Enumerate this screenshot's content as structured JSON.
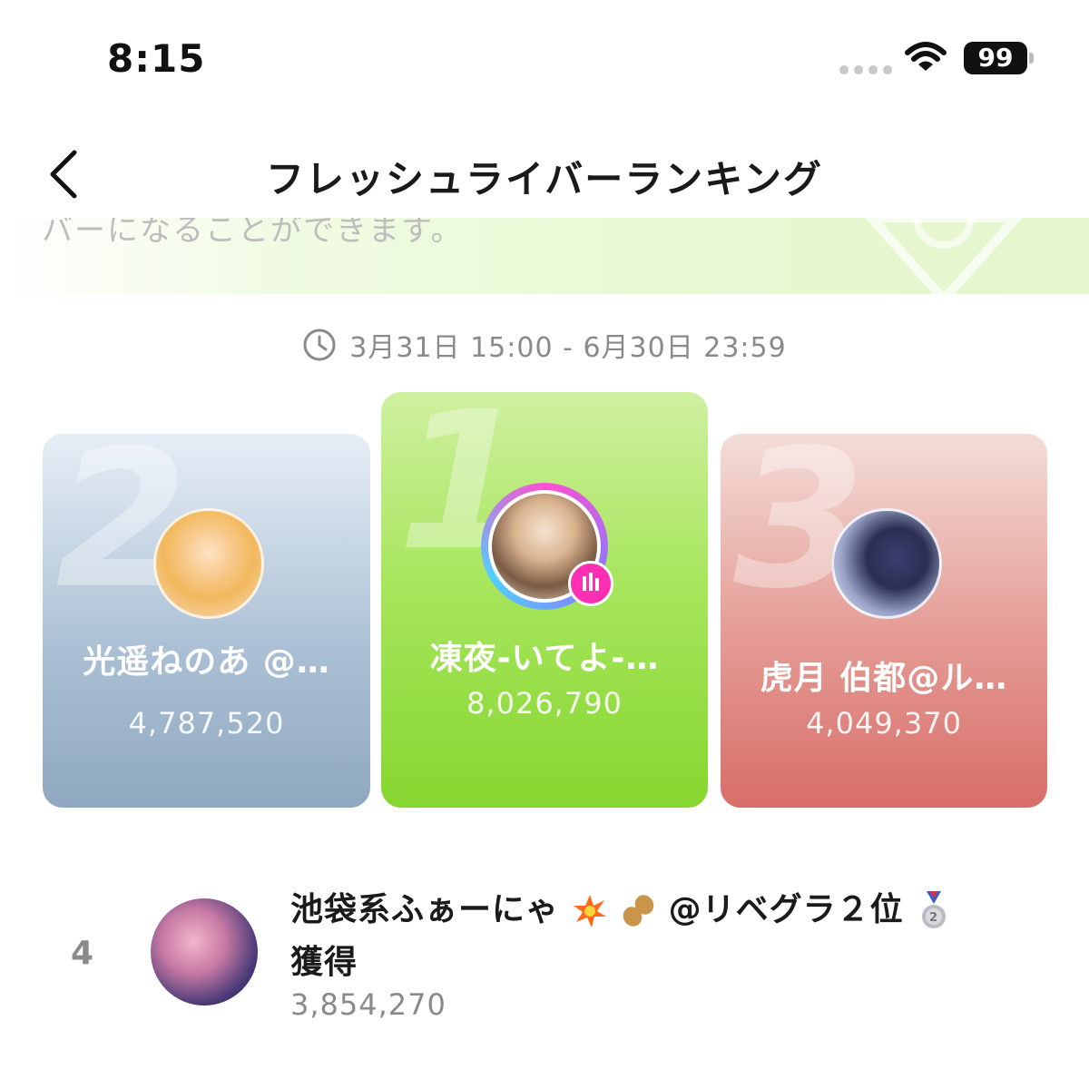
{
  "status_bar": {
    "time": "8:15",
    "battery": "99"
  },
  "nav": {
    "title": "フレッシュライバーランキング"
  },
  "banner": {
    "text": "バーになることができます。"
  },
  "period": {
    "text": "3月31日 15:00 - 6月30日 23:59"
  },
  "podium": [
    {
      "rank": "2",
      "name": "光遥ねのあ @…",
      "score": "4,787,520"
    },
    {
      "rank": "1",
      "name": "凍夜-いてよ-…",
      "score": "8,026,790"
    },
    {
      "rank": "3",
      "name": "虎月 伯都@ル…",
      "score": "4,049,370"
    }
  ],
  "list": [
    {
      "rank": "4",
      "name_part1": "池袋系ふぁーにゃ",
      "name_part2": "@リベグラ２位",
      "name_part3": "獲得",
      "score": "3,854,270"
    }
  ],
  "colors": {
    "card1": "#a8e65e",
    "card2": "#a9bed3",
    "card3": "#e49a93",
    "live_badge": "#ff2fb3"
  },
  "icons": [
    "wifi-icon",
    "battery-icon",
    "back-chevron-icon",
    "clock-icon",
    "live-badge-icon",
    "explosion-emoji",
    "peanut-emoji",
    "silver-medal-emoji"
  ]
}
